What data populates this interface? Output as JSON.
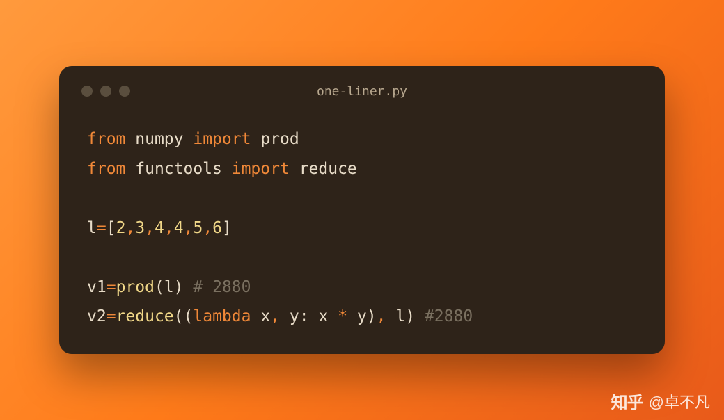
{
  "filename": "one-liner.py",
  "code": {
    "l1_from": "from",
    "l1_mod": "numpy",
    "l1_import": "import",
    "l1_name": "prod",
    "l2_from": "from",
    "l2_mod": "functools",
    "l2_import": "import",
    "l2_name": "reduce",
    "l4_var": "l",
    "l4_eq": "=",
    "l4_lb": "[",
    "l4_n1": "2",
    "l4_c1": ",",
    "l4_n2": "3",
    "l4_c2": ",",
    "l4_n3": "4",
    "l4_c3": ",",
    "l4_n4": "4",
    "l4_c4": ",",
    "l4_n5": "5",
    "l4_c5": ",",
    "l4_n6": "6",
    "l4_rb": "]",
    "l6_var": "v1",
    "l6_eq": "=",
    "l6_fn": "prod",
    "l6_lp": "(",
    "l6_arg": "l",
    "l6_rp": ")",
    "l6_comment": "# 2880",
    "l7_var": "v2",
    "l7_eq": "=",
    "l7_fn": "reduce",
    "l7_lp": "(",
    "l7_lp2": "(",
    "l7_lambda": "lambda",
    "l7_x": "x",
    "l7_c1": ",",
    "l7_y": "y",
    "l7_colon": ":",
    "l7_x2": "x",
    "l7_star": "*",
    "l7_y2": "y",
    "l7_rp2": ")",
    "l7_c2": ",",
    "l7_l": "l",
    "l7_rp": ")",
    "l7_comment": "#2880"
  },
  "watermark": {
    "logo": "知乎",
    "author": "@卓不凡"
  }
}
